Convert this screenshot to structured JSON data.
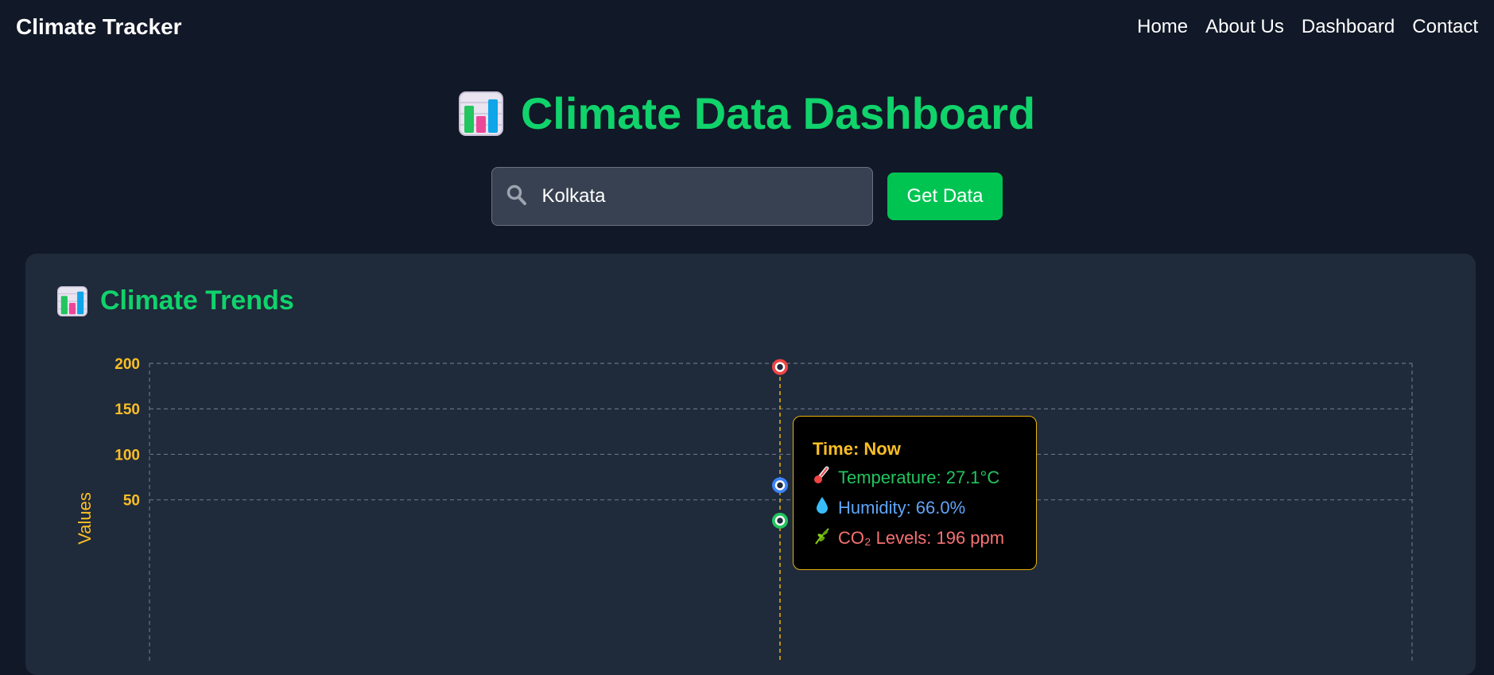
{
  "nav": {
    "brand": "Climate Tracker",
    "links": [
      "Home",
      "About Us",
      "Dashboard",
      "Contact"
    ]
  },
  "hero": {
    "title": "Climate Data Dashboard",
    "icon": "bar-chart-emoji"
  },
  "search": {
    "value": "Kolkata",
    "button_label": "Get Data"
  },
  "card": {
    "title": "Climate Trends",
    "icon": "bar-chart-emoji"
  },
  "tooltip": {
    "title": "Time: Now",
    "temperature": "Temperature: 27.1°C",
    "humidity": "Humidity: 66.0%",
    "co2": "CO₂ Levels: 196 ppm"
  },
  "chart_data": {
    "type": "line",
    "ylabel": "Values",
    "y_ticks": [
      "200",
      "150",
      "100",
      "50"
    ],
    "ylim": [
      0,
      200
    ],
    "grid": true,
    "categories": [
      "Now"
    ],
    "series": [
      {
        "name": "Temperature",
        "unit": "°C",
        "values": [
          27.1
        ],
        "color": "#22c55e"
      },
      {
        "name": "Humidity",
        "unit": "%",
        "values": [
          66.0
        ],
        "color": "#3b82f6"
      },
      {
        "name": "CO₂ Levels",
        "unit": "ppm",
        "values": [
          196
        ],
        "color": "#ef4444"
      }
    ]
  },
  "colors": {
    "background": "#111827",
    "card": "#1f2a3b",
    "accent_green": "#10d36b",
    "button_green": "#00c452",
    "axis_yellow": "#fbbf24"
  }
}
